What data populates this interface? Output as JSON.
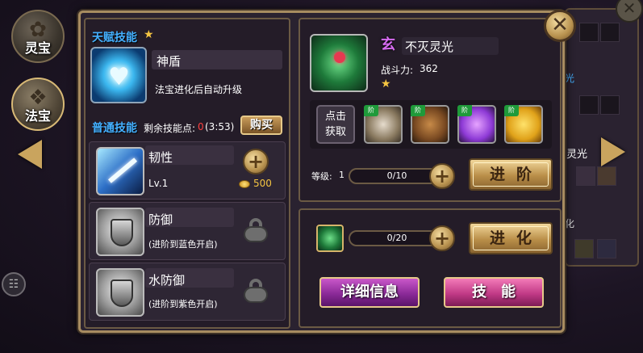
{
  "nav": {
    "lingbao_label": "灵宝",
    "fabao_label": "法宝"
  },
  "talent": {
    "section_title": "天赋技能",
    "skill_name": "神盾",
    "skill_desc": "法宝进化后自动升级"
  },
  "normal": {
    "section_title": "普通技能",
    "points_label": "剩余技能点:",
    "points_value": "0",
    "timer": "(3:53)",
    "buy_label": "购买"
  },
  "skills": [
    {
      "name": "韧性",
      "level": "Lv.1",
      "cost": "500"
    },
    {
      "name": "防御",
      "requirement": "(进阶到蓝色开启)"
    },
    {
      "name": "水防御",
      "requirement": "(进阶到紫色开启)"
    }
  ],
  "artifact": {
    "grade_badge": "玄",
    "name": "不灭灵光",
    "power_label": "战斗力:",
    "power_value": "362"
  },
  "materials": {
    "click_label_1": "点击",
    "click_label_2": "获取",
    "tag": "阶"
  },
  "advance": {
    "level_label": "等级:",
    "level_value": "1",
    "progress": "0/10",
    "progress_fraction": 0,
    "button": "进阶"
  },
  "evolve": {
    "progress": "0/20",
    "progress_fraction": 0,
    "button": "进化"
  },
  "bottom": {
    "detail_button": "详细信息",
    "skill_button": "技能"
  },
  "background_peek": {
    "text_1": "灵光",
    "text_2": "光",
    "text_3": "化"
  },
  "colors": {
    "accent_blue": "#44b0ff",
    "gold": "#c9a45e",
    "warning_red": "#ff4040",
    "coin_yellow": "#f5c542"
  }
}
